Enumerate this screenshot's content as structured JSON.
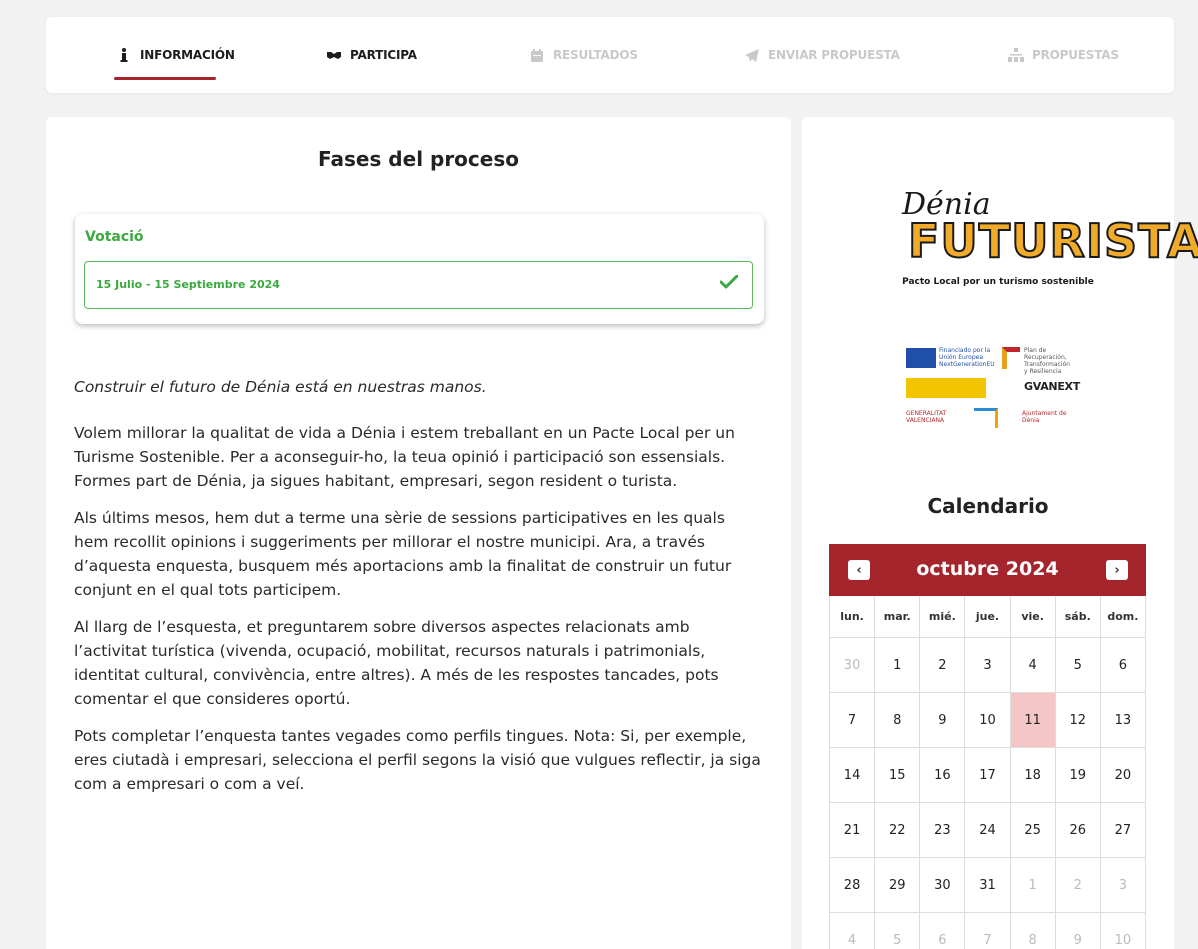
{
  "tabs": [
    {
      "label": "INFORMACIÓN",
      "icon": "info-icon",
      "state": "active"
    },
    {
      "label": "PARTICIPA",
      "icon": "handshake-icon",
      "state": "normal"
    },
    {
      "label": "RESULTADOS",
      "icon": "calendar-icon",
      "state": "disabled"
    },
    {
      "label": "ENVIAR PROPUESTA",
      "icon": "paper-plane-icon",
      "state": "disabled"
    },
    {
      "label": "PROPUESTAS",
      "icon": "sitemap-icon",
      "state": "disabled"
    }
  ],
  "main": {
    "title": "Fases del proceso",
    "phase": {
      "title": "Votació",
      "dates": "15 Julio - 15 Septiembre 2024",
      "status_icon": "check-icon"
    },
    "paragraphs": [
      "Construir el futuro de Dénia está en nuestras manos.",
      "Volem millorar la qualitat de vida a Dénia i estem treballant en un Pacte Local per un Turisme Sostenible. Per a aconseguir-ho, la teua opinió i participació son essensials. Formes part de Dénia, ja sigues habitant, empresari, segon resident o turista.",
      "Als últims mesos, hem dut a terme una sèrie de sessions participatives en les quals hem recollit opinions i suggeriments per millorar el nostre municipi. Ara, a través d’aquesta enquesta, busquem més aportacions amb la finalitat de construir un futur conjunt en el qual tots participem.",
      "Al llarg de l’esquesta, et preguntarem sobre diversos aspectes relacionats amb l’activitat turística (vivenda, ocupació, mobilitat, recursos naturals i patrimonials, identitat cultural, convivència, entre altres). A més de les respostes tancades, pots comentar el que consideres oportú.",
      "Pots completar l’enquesta tantes vegades  como perfils tingues. Nota: Si, per exemple, eres ciutadà i empresari, selecciona el perfil segons la visió que vulgues reflectir, ja siga com a empresari o com a veí."
    ]
  },
  "sidebar": {
    "logo": {
      "script": "Dénia",
      "name": "FUTURISTA",
      "tagline": "Pacto Local por un turismo sostenible"
    },
    "sponsors": {
      "eu": "Financiado por la Unión Europea NextGenerationEU",
      "plan": "Plan de Recuperación, Transformación y Resiliencia",
      "gva": "GVANEXT",
      "generalitat": "GENERALITAT VALENCIANA",
      "ajuntament": "Ajuntament de Dénia"
    },
    "calendar_title": "Calendario",
    "calendar": {
      "month": "octubre 2024",
      "prev": "‹",
      "next": "›",
      "weekdays": [
        "lun.",
        "mar.",
        "mié.",
        "jue.",
        "vie.",
        "sáb.",
        "dom."
      ],
      "days": [
        "30",
        "1",
        "2",
        "3",
        "4",
        "5",
        "6",
        "7",
        "8",
        "9",
        "10",
        "11",
        "12",
        "13",
        "14",
        "15",
        "16",
        "17",
        "18",
        "19",
        "20",
        "21",
        "22",
        "23",
        "24",
        "25",
        "26",
        "27",
        "28",
        "29",
        "30",
        "31",
        "1",
        "2",
        "3",
        "4",
        "5",
        "6",
        "7",
        "8",
        "9",
        "10"
      ],
      "other_month_indices": [
        0,
        32,
        33,
        34,
        35,
        36,
        37,
        38,
        39,
        40,
        41
      ],
      "today_index": 11
    }
  },
  "colors": {
    "accent": "#a4262c",
    "success": "#3aa93f",
    "today": "#f4c6c6",
    "logo_yellow": "#f1ab2b"
  }
}
